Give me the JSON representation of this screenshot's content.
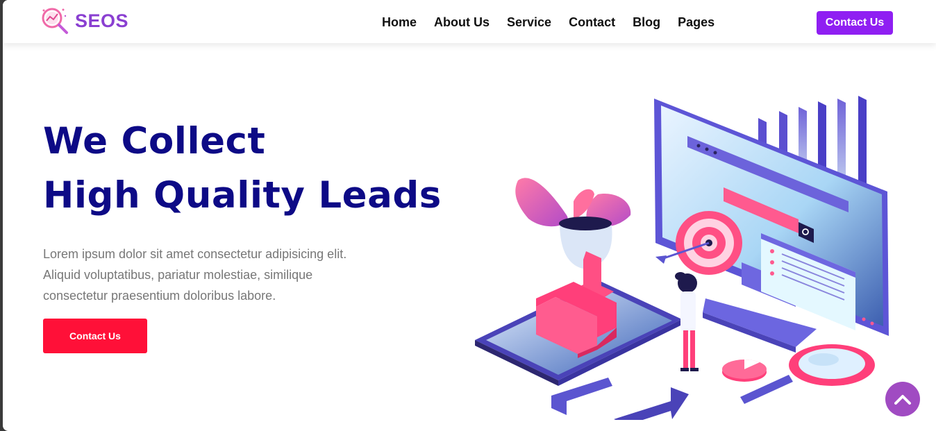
{
  "brand": {
    "name": "SEOS",
    "logo_icon": "magnifier-chart-icon"
  },
  "nav": {
    "items": [
      {
        "label": "Home"
      },
      {
        "label": "About Us"
      },
      {
        "label": "Service"
      },
      {
        "label": "Contact"
      },
      {
        "label": "Blog"
      },
      {
        "label": "Pages"
      }
    ],
    "cta_label": "Contact Us"
  },
  "hero": {
    "title_line1": "We Collect",
    "title_line2": "High Quality Leads",
    "description": "Lorem ipsum dolor sit amet consectetur adipisicing elit. Aliquid voluptatibus, pariatur molestiae, similique consectetur praesentium doloribus labore.",
    "cta_label": "Contact Us",
    "illustration": "seo-analytics-illustration"
  },
  "scroll_top": {
    "icon": "chevron-up-icon"
  },
  "colors": {
    "brand_purple": "#8a3fd1",
    "nav_button": "#8f1ff2",
    "title_navy": "#0d0a86",
    "hero_button": "#ff1038",
    "scroll_button": "#a04bc2"
  }
}
